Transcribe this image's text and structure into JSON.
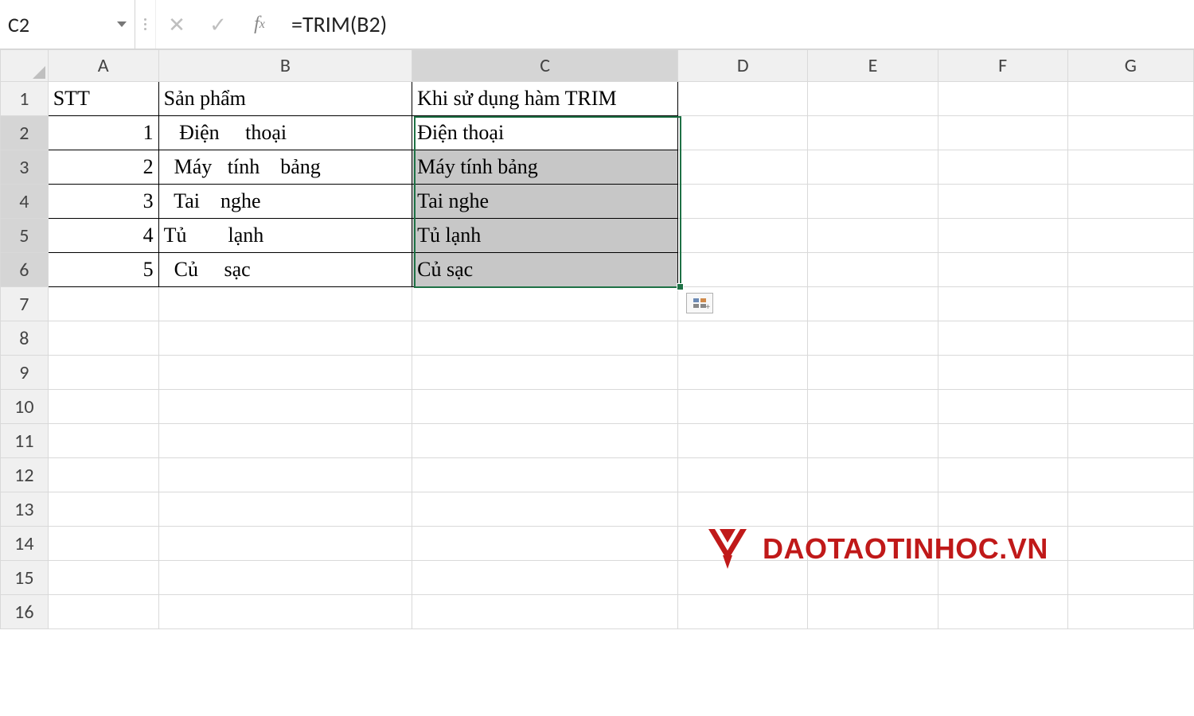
{
  "formula_bar": {
    "cell_ref": "C2",
    "cancel_symbol": "✕",
    "confirm_symbol": "✓",
    "fx_label": "fx",
    "formula": "=TRIM(B2)"
  },
  "columns": [
    "A",
    "B",
    "C",
    "D",
    "E",
    "F",
    "G"
  ],
  "row_headers": [
    "1",
    "2",
    "3",
    "4",
    "5",
    "6",
    "7",
    "8",
    "9",
    "10",
    "11",
    "12",
    "13",
    "14",
    "15",
    "16"
  ],
  "selected_column": "C",
  "selected_rows_start": 2,
  "selected_rows_end": 6,
  "table": {
    "headers": {
      "A": "STT",
      "B": "Sản phẩm",
      "C": "Khi sử dụng hàm TRIM"
    },
    "rows": [
      {
        "stt": "1",
        "b": "   Điện     thoại",
        "c": "Điện thoại"
      },
      {
        "stt": "2",
        "b": "  Máy   tính    bảng",
        "c": "Máy tính bảng"
      },
      {
        "stt": "3",
        "b": "  Tai    nghe",
        "c": "Tai nghe"
      },
      {
        "stt": "4",
        "b": "Tủ        lạnh",
        "c": "Tủ lạnh"
      },
      {
        "stt": "5",
        "b": "  Củ     sạc",
        "c": "Củ sạc"
      }
    ]
  },
  "watermark": {
    "text": "DAOTAOTINHOC.VN",
    "color": "#c01919"
  }
}
